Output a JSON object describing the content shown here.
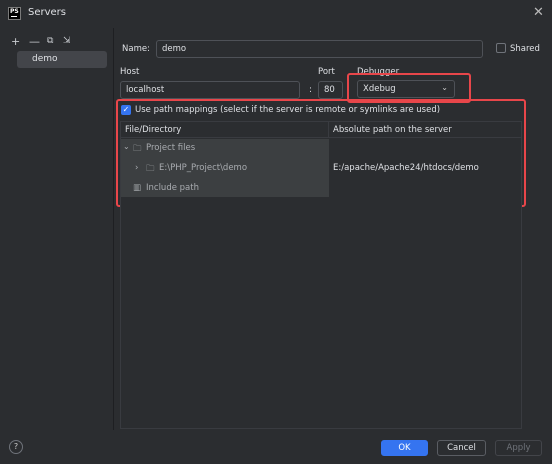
{
  "window": {
    "title": "Servers",
    "logo_text": "PS"
  },
  "toolbar": {
    "add": "+",
    "remove": "—",
    "copy": "⧉",
    "move": "⇲"
  },
  "servers": [
    {
      "label": "demo"
    }
  ],
  "form": {
    "name_label": "Name:",
    "name_value": "demo",
    "shared_label": "Shared",
    "host_label": "Host",
    "host_value": "localhost",
    "colon": ":",
    "port_label": "Port",
    "port_value": "80",
    "debugger_label": "Debugger",
    "debugger_value": "Xdebug",
    "use_path_mappings_label": "Use path mappings (select if the server is remote or symlinks are used)"
  },
  "table": {
    "headers": [
      "File/Directory",
      "Absolute path on the server"
    ],
    "rows": [
      {
        "label": "Project files",
        "server_path": ""
      },
      {
        "label": "E:\\PHP_Project\\demo",
        "server_path": "E:/apache/Apache24/htdocs/demo"
      },
      {
        "label": "Include path",
        "server_path": ""
      }
    ]
  },
  "buttons": {
    "ok": "OK",
    "cancel": "Cancel",
    "apply": "Apply",
    "help": "?"
  },
  "colors": {
    "accent": "#3574f0",
    "highlight": "#e8464a",
    "background": "#2b2d30"
  }
}
